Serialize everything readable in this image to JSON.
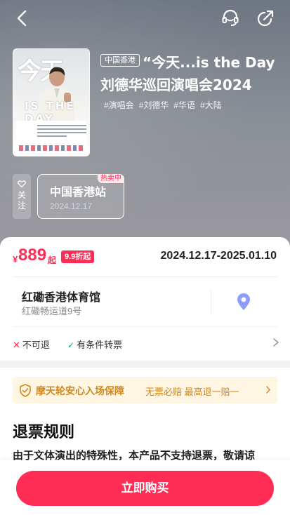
{
  "header": {
    "back_icon": "chevron-left-icon",
    "service_icon": "headset-icon",
    "share_icon": "share-icon"
  },
  "poster": {
    "title_text": "今天",
    "subtitle_text": "IS THE DAY"
  },
  "event": {
    "region_tag": "中国香港",
    "title": "“今天...is the Day刘德华巡回演唱会2024",
    "tags": [
      "#演唱会",
      "#刘德华",
      "#华语",
      "#大陆"
    ]
  },
  "follow": {
    "label": "关注",
    "icon": "heart-icon"
  },
  "session": {
    "name": "中国香港站",
    "date": "2024.12.17",
    "badge": "热卖中"
  },
  "pricing": {
    "currency": "¥",
    "price": "889",
    "unit": "起",
    "discount": "9.9折起",
    "date_range": "2024.12.17-2025.01.10"
  },
  "venue": {
    "name": "红磡香港体育馆",
    "address": "红磡畅运道9号",
    "icon": "location-pin-icon"
  },
  "policies": {
    "no_refund": "不可退",
    "transfer": "有条件转票"
  },
  "guarantee": {
    "title": "摩天轮安心入场保障",
    "subtitle": "无票必赔 最高退一赔一"
  },
  "refund": {
    "title": "退票规则",
    "text": "由于文体演出的特殊性，本产品不支持退票，敬请谅"
  },
  "actions": {
    "buy_label": "立即购买"
  },
  "colors": {
    "accent": "#ff2d55",
    "guarantee": "#d2891f",
    "guarantee_bg": "#fff5e3"
  }
}
